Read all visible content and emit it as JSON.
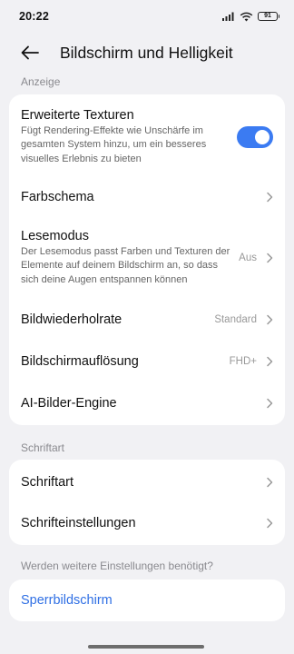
{
  "status_bar": {
    "time": "20:22",
    "battery": "91"
  },
  "header": {
    "title": "Bildschirm und Helligkeit"
  },
  "sections": {
    "display_label": "Anzeige",
    "font_label": "Schriftart",
    "more_label": "Werden weitere Einstellungen benötigt?"
  },
  "display": {
    "advanced_textures": {
      "title": "Erweiterte Texturen",
      "subtitle": "Fügt Rendering-Effekte wie Unschärfe im gesamten System hinzu, um ein besseres visuelles Erlebnis zu bieten",
      "enabled": true
    },
    "color_scheme": {
      "title": "Farbschema"
    },
    "reading_mode": {
      "title": "Lesemodus",
      "subtitle": "Der Lesemodus passt Farben und Texturen der Elemente auf deinem Bildschirm an, so dass sich deine Augen entspannen können",
      "value": "Aus"
    },
    "refresh_rate": {
      "title": "Bildwiederholrate",
      "value": "Standard"
    },
    "resolution": {
      "title": "Bildschirmauflösung",
      "value": "FHD+"
    },
    "ai_engine": {
      "title": "AI-Bilder-Engine"
    }
  },
  "font": {
    "font_item": {
      "title": "Schriftart"
    },
    "font_settings": {
      "title": "Schrifteinstellungen"
    }
  },
  "more": {
    "lock_screen": {
      "title": "Sperrbildschirm"
    }
  },
  "colors": {
    "accent": "#3b7bf2",
    "link": "#2f6fe4",
    "background": "#f1f1f4",
    "card": "#ffffff"
  }
}
